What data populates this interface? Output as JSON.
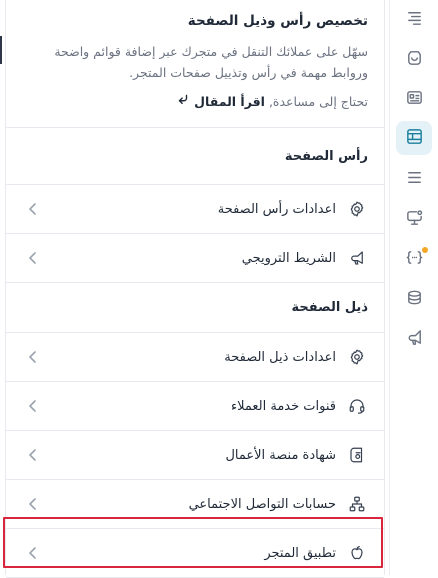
{
  "intro": {
    "title": "تخصيص رأس وذيل الصفحة",
    "description": "سهّل على عملائك التنقل في متجرك عبر إضافة قوائم واضحة وروابط مهمة في رأس وتذييل صفحات المتجر.",
    "help_text": "تحتاج إلى مساعدة,",
    "help_link": "اقرأ المقال"
  },
  "sections": {
    "header": {
      "title": "رأس الصفحة",
      "items": [
        {
          "label": "اعدادات رأس الصفحة",
          "icon": "gear-icon"
        },
        {
          "label": "الشريط الترويجي",
          "icon": "megaphone-icon"
        }
      ]
    },
    "footer": {
      "title": "ذيل الصفحة",
      "items": [
        {
          "label": "اعدادات ذيل الصفحة",
          "icon": "gear-icon"
        },
        {
          "label": "قنوات خدمة العملاء",
          "icon": "headset-icon"
        },
        {
          "label": "شهادة منصة الأعمال",
          "icon": "certificate-icon"
        },
        {
          "label": "حسابات التواصل الاجتماعي",
          "icon": "social-network-icon"
        },
        {
          "label": "تطبيق المتجر",
          "icon": "apple-icon"
        }
      ]
    }
  },
  "rail": {
    "items": [
      "text-align-icon",
      "shop-bag-icon",
      "id-card-icon",
      "layout-icon",
      "menu-lines-icon",
      "monitor-settings-icon",
      "code-braces-icon",
      "coins-icon",
      "megaphone-icon"
    ],
    "active_index": 3,
    "badge_index": 6,
    "badge_color": "#f5a623"
  },
  "colors": {
    "accent_bg": "#e4f1f6",
    "highlight": "#d7263d"
  }
}
